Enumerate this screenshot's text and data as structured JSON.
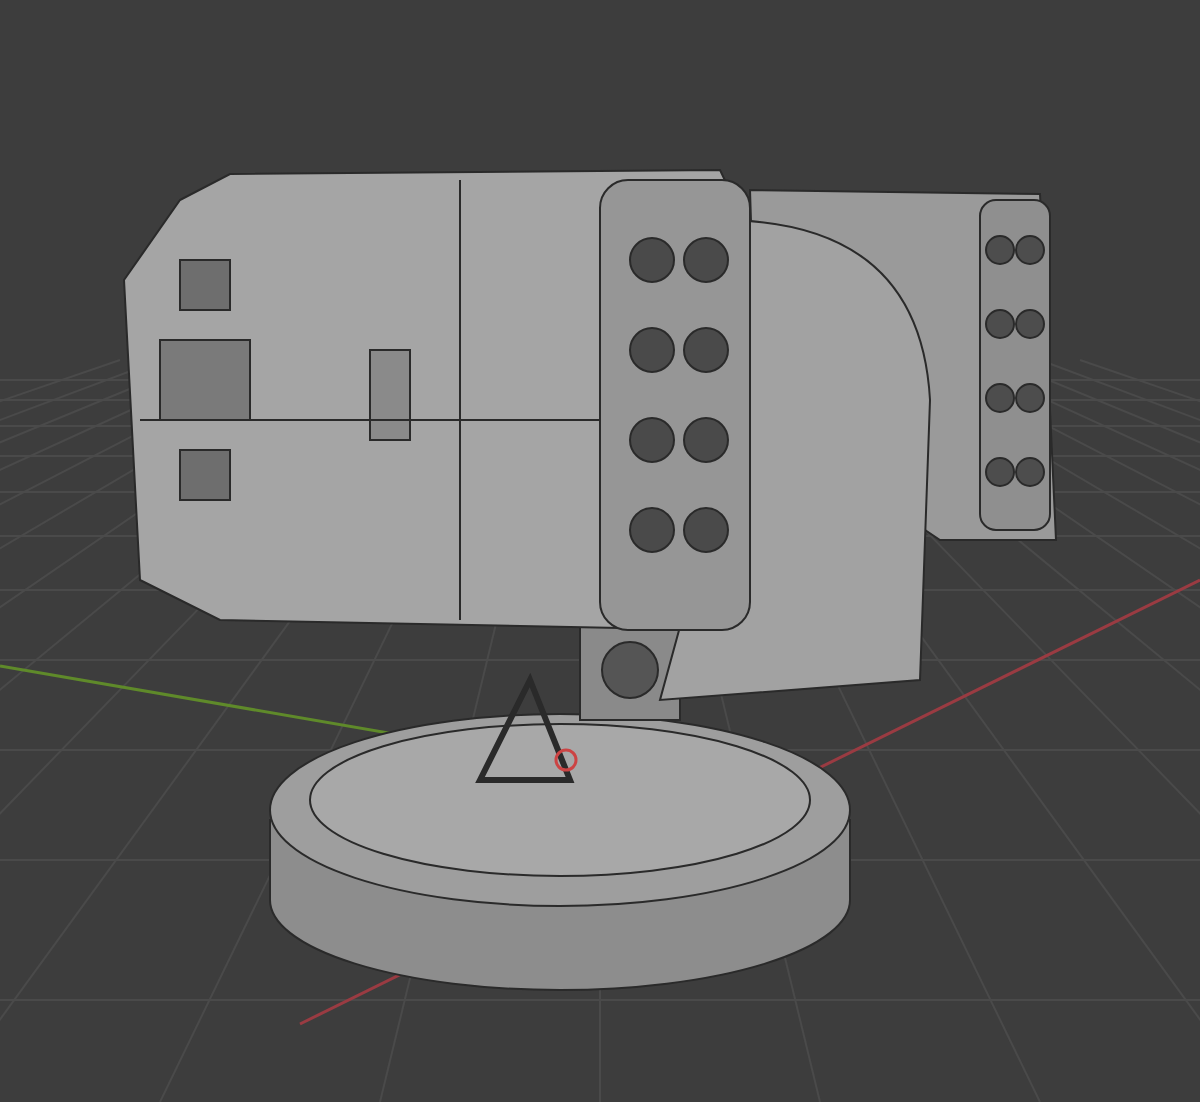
{
  "viewport": {
    "grid": true,
    "axes": [
      {
        "kind": "horizontal",
        "color": "#9a3b42"
      },
      {
        "kind": "depth",
        "color": "#5f8a2a"
      }
    ]
  }
}
